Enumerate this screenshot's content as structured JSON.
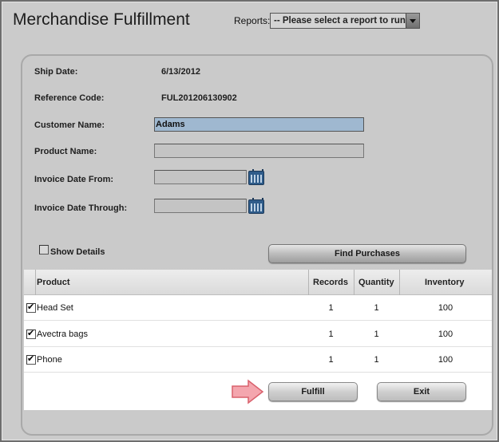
{
  "app": {
    "title": "Merchandise Fulfillment"
  },
  "reports": {
    "label": "Reports:",
    "selected": "-- Please select a report to run: --"
  },
  "form": {
    "ship_date_label": "Ship Date:",
    "ship_date_value": "6/13/2012",
    "reference_code_label": "Reference Code:",
    "reference_code_value": "FUL201206130902",
    "customer_name_label": "Customer Name:",
    "customer_name_value": "Adams",
    "product_name_label": "Product Name:",
    "product_name_value": "",
    "invoice_from_label": "Invoice Date From:",
    "invoice_from_value": "",
    "invoice_through_label": "Invoice Date Through:",
    "invoice_through_value": "",
    "show_details_label": "Show Details",
    "show_details_checked": false,
    "find_button": "Find Purchases"
  },
  "grid": {
    "columns": [
      "Product",
      "Records",
      "Quantity",
      "Inventory"
    ],
    "rows": [
      {
        "checked": true,
        "product": "Head Set",
        "records": "1",
        "quantity": "1",
        "inventory": "100"
      },
      {
        "checked": true,
        "product": "Avectra bags",
        "records": "1",
        "quantity": "1",
        "inventory": "100"
      },
      {
        "checked": true,
        "product": "Phone",
        "records": "1",
        "quantity": "1",
        "inventory": "100"
      }
    ]
  },
  "actions": {
    "fulfill": "Fulfill",
    "exit": "Exit"
  },
  "colors": {
    "selected_field": "#9fb8d0",
    "calendar_icon": "#2f5c8a",
    "pointer_arrow": "#f4a6ae"
  }
}
